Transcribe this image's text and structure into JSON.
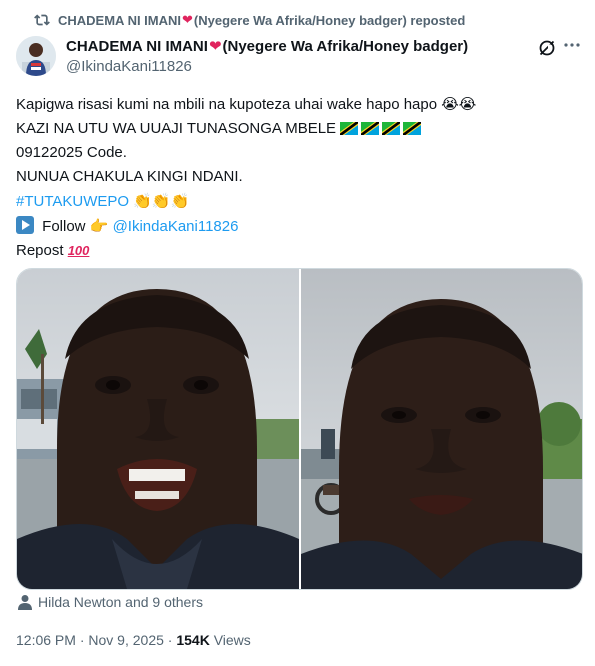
{
  "repost": {
    "name": "CHADEMA NI IMANI",
    "suffix": "(Nyegere Wa Afrika/Honey badger) reposted"
  },
  "author": {
    "name": "CHADEMA NI IMANI",
    "name_suffix": "(Nyegere Wa Afrika/Honey badger)",
    "handle": "@IkindaKani11826"
  },
  "tweet": {
    "line1": "Kapigwa risasi kumi na mbili na kupoteza uhai wake hapo hapo",
    "line2": "KAZI NA UTU WA UUAJI TUNASONGA MBELE",
    "line3": "09122025 Code.",
    "line4": "NUNUA CHAKULA KINGI NDANI.",
    "hashtag": "#TUTAKUWEPO",
    "follow_text": "Follow",
    "follow_mention": "@IkindaKani11826",
    "repost_text": "Repost"
  },
  "media": {
    "count": 2
  },
  "likes": {
    "text": "Hilda Newton and 9 others"
  },
  "meta": {
    "time": "12:06 PM",
    "date": "Nov 9, 2025",
    "views_count": "154K",
    "views_label": "Views"
  },
  "icons": {
    "repost": "repost-icon",
    "grok": "grok-icon",
    "more": "more-icon",
    "person": "person-icon"
  },
  "colors": {
    "link": "#1d9bf0",
    "secondary_text": "#536471",
    "primary_text": "#0f1419",
    "heart": "#e0245e"
  }
}
